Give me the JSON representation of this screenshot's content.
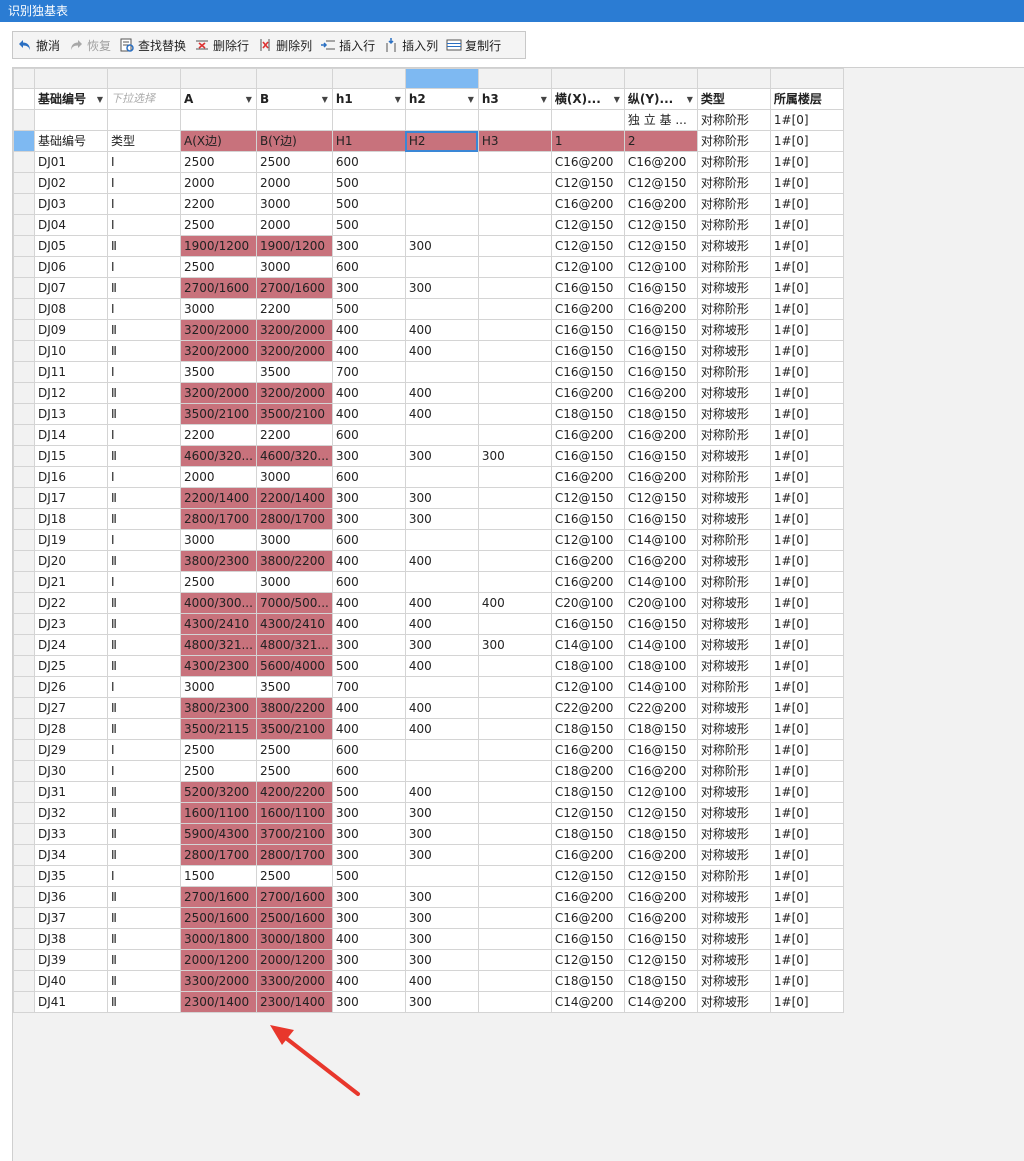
{
  "window": {
    "title": "识别独基表"
  },
  "toolbar": {
    "undo": "撤消",
    "redo": "恢复",
    "find_replace": "查找替换",
    "delete_row": "删除行",
    "delete_col": "删除列",
    "insert_row": "插入行",
    "insert_col": "插入列",
    "copy_row": "复制行"
  },
  "headers": [
    "基础编号",
    "下拉选择",
    "A",
    "B",
    "h1",
    "h2",
    "h3",
    "横(X)...",
    "纵(Y)...",
    "类型",
    "所属楼层"
  ],
  "row_blank": [
    "",
    "",
    "",
    "",
    "",
    "",
    "",
    "",
    "独 立 基 ...",
    "对称阶形",
    "1#[0]"
  ],
  "row_labels": [
    "基础编号",
    "类型",
    "A(X边)",
    "B(Y边)",
    "H1",
    "H2",
    "H3",
    "1",
    "2",
    "对称阶形",
    "1#[0]"
  ],
  "rows": [
    [
      "DJ01",
      "Ⅰ",
      "2500",
      "2500",
      "600",
      "",
      "",
      "C16@200",
      "C16@200",
      "对称阶形",
      "1#[0]"
    ],
    [
      "DJ02",
      "Ⅰ",
      "2000",
      "2000",
      "500",
      "",
      "",
      "C12@150",
      "C12@150",
      "对称阶形",
      "1#[0]"
    ],
    [
      "DJ03",
      "Ⅰ",
      "2200",
      "3000",
      "500",
      "",
      "",
      "C16@200",
      "C16@200",
      "对称阶形",
      "1#[0]"
    ],
    [
      "DJ04",
      "Ⅰ",
      "2500",
      "2000",
      "500",
      "",
      "",
      "C12@150",
      "C12@150",
      "对称阶形",
      "1#[0]"
    ],
    [
      "DJ05",
      "Ⅱ",
      "1900/1200",
      "1900/1200",
      "300",
      "300",
      "",
      "C12@150",
      "C12@150",
      "对称坡形",
      "1#[0]"
    ],
    [
      "DJ06",
      "Ⅰ",
      "2500",
      "3000",
      "600",
      "",
      "",
      "C12@100",
      "C12@100",
      "对称阶形",
      "1#[0]"
    ],
    [
      "DJ07",
      "Ⅱ",
      "2700/1600",
      "2700/1600",
      "300",
      "300",
      "",
      "C16@150",
      "C16@150",
      "对称坡形",
      "1#[0]"
    ],
    [
      "DJ08",
      "Ⅰ",
      "3000",
      "2200",
      "500",
      "",
      "",
      "C16@200",
      "C16@200",
      "对称阶形",
      "1#[0]"
    ],
    [
      "DJ09",
      "Ⅱ",
      "3200/2000",
      "3200/2000",
      "400",
      "400",
      "",
      "C16@150",
      "C16@150",
      "对称坡形",
      "1#[0]"
    ],
    [
      "DJ10",
      "Ⅱ",
      "3200/2000",
      "3200/2000",
      "400",
      "400",
      "",
      "C16@150",
      "C16@150",
      "对称坡形",
      "1#[0]"
    ],
    [
      "DJ11",
      "Ⅰ",
      "3500",
      "3500",
      "700",
      "",
      "",
      "C16@150",
      "C16@150",
      "对称阶形",
      "1#[0]"
    ],
    [
      "DJ12",
      "Ⅱ",
      "3200/2000",
      "3200/2000",
      "400",
      "400",
      "",
      "C16@200",
      "C16@200",
      "对称坡形",
      "1#[0]"
    ],
    [
      "DJ13",
      "Ⅱ",
      "3500/2100",
      "3500/2100",
      "400",
      "400",
      "",
      "C18@150",
      "C18@150",
      "对称坡形",
      "1#[0]"
    ],
    [
      "DJ14",
      "Ⅰ",
      "2200",
      "2200",
      "600",
      "",
      "",
      "C16@200",
      "C16@200",
      "对称阶形",
      "1#[0]"
    ],
    [
      "DJ15",
      "Ⅱ",
      "4600/320...",
      "4600/320...",
      "300",
      "300",
      "300",
      "C16@150",
      "C16@150",
      "对称坡形",
      "1#[0]"
    ],
    [
      "DJ16",
      "Ⅰ",
      "2000",
      "3000",
      "600",
      "",
      "",
      "C16@200",
      "C16@200",
      "对称阶形",
      "1#[0]"
    ],
    [
      "DJ17",
      "Ⅱ",
      "2200/1400",
      "2200/1400",
      "300",
      "300",
      "",
      "C12@150",
      "C12@150",
      "对称坡形",
      "1#[0]"
    ],
    [
      "DJ18",
      "Ⅱ",
      "2800/1700",
      "2800/1700",
      "300",
      "300",
      "",
      "C16@150",
      "C16@150",
      "对称坡形",
      "1#[0]"
    ],
    [
      "DJ19",
      "Ⅰ",
      "3000",
      "3000",
      "600",
      "",
      "",
      "C12@100",
      "C14@100",
      "对称阶形",
      "1#[0]"
    ],
    [
      "DJ20",
      "Ⅱ",
      "3800/2300",
      "3800/2200",
      "400",
      "400",
      "",
      "C16@200",
      "C16@200",
      "对称坡形",
      "1#[0]"
    ],
    [
      "DJ21",
      "Ⅰ",
      "2500",
      "3000",
      "600",
      "",
      "",
      "C16@200",
      "C14@100",
      "对称阶形",
      "1#[0]"
    ],
    [
      "DJ22",
      "Ⅱ",
      "4000/300...",
      "7000/500...",
      "400",
      "400",
      "400",
      "C20@100",
      "C20@100",
      "对称坡形",
      "1#[0]"
    ],
    [
      "DJ23",
      "Ⅱ",
      "4300/2410",
      "4300/2410",
      "400",
      "400",
      "",
      "C16@150",
      "C16@150",
      "对称坡形",
      "1#[0]"
    ],
    [
      "DJ24",
      "Ⅱ",
      "4800/321...",
      "4800/321...",
      "300",
      "300",
      "300",
      "C14@100",
      "C14@100",
      "对称坡形",
      "1#[0]"
    ],
    [
      "DJ25",
      "Ⅱ",
      "4300/2300",
      "5600/4000",
      "500",
      "400",
      "",
      "C18@100",
      "C18@100",
      "对称坡形",
      "1#[0]"
    ],
    [
      "DJ26",
      "Ⅰ",
      "3000",
      "3500",
      "700",
      "",
      "",
      "C12@100",
      "C14@100",
      "对称阶形",
      "1#[0]"
    ],
    [
      "DJ27",
      "Ⅱ",
      "3800/2300",
      "3800/2200",
      "400",
      "400",
      "",
      "C22@200",
      "C22@200",
      "对称坡形",
      "1#[0]"
    ],
    [
      "DJ28",
      "Ⅱ",
      "3500/2115",
      "3500/2100",
      "400",
      "400",
      "",
      "C18@150",
      "C18@150",
      "对称坡形",
      "1#[0]"
    ],
    [
      "DJ29",
      "Ⅰ",
      "2500",
      "2500",
      "600",
      "",
      "",
      "C16@200",
      "C16@150",
      "对称阶形",
      "1#[0]"
    ],
    [
      "DJ30",
      "Ⅰ",
      "2500",
      "2500",
      "600",
      "",
      "",
      "C18@200",
      "C16@200",
      "对称阶形",
      "1#[0]"
    ],
    [
      "DJ31",
      "Ⅱ",
      "5200/3200",
      "4200/2200",
      "500",
      "400",
      "",
      "C18@150",
      "C12@100",
      "对称坡形",
      "1#[0]"
    ],
    [
      "DJ32",
      "Ⅱ",
      "1600/1100",
      "1600/1100",
      "300",
      "300",
      "",
      "C12@150",
      "C12@150",
      "对称坡形",
      "1#[0]"
    ],
    [
      "DJ33",
      "Ⅱ",
      "5900/4300",
      "3700/2100",
      "300",
      "300",
      "",
      "C18@150",
      "C18@150",
      "对称坡形",
      "1#[0]"
    ],
    [
      "DJ34",
      "Ⅱ",
      "2800/1700",
      "2800/1700",
      "300",
      "300",
      "",
      "C16@200",
      "C16@200",
      "对称坡形",
      "1#[0]"
    ],
    [
      "DJ35",
      "Ⅰ",
      "1500",
      "2500",
      "500",
      "",
      "",
      "C12@150",
      "C12@150",
      "对称阶形",
      "1#[0]"
    ],
    [
      "DJ36",
      "Ⅱ",
      "2700/1600",
      "2700/1600",
      "300",
      "300",
      "",
      "C16@200",
      "C16@200",
      "对称坡形",
      "1#[0]"
    ],
    [
      "DJ37",
      "Ⅱ",
      "2500/1600",
      "2500/1600",
      "300",
      "300",
      "",
      "C16@200",
      "C16@200",
      "对称坡形",
      "1#[0]"
    ],
    [
      "DJ38",
      "Ⅱ",
      "3000/1800",
      "3000/1800",
      "400",
      "300",
      "",
      "C16@150",
      "C16@150",
      "对称坡形",
      "1#[0]"
    ],
    [
      "DJ39",
      "Ⅱ",
      "2000/1200",
      "2000/1200",
      "300",
      "300",
      "",
      "C12@150",
      "C12@150",
      "对称坡形",
      "1#[0]"
    ],
    [
      "DJ40",
      "Ⅱ",
      "3300/2000",
      "3300/2000",
      "400",
      "400",
      "",
      "C18@150",
      "C18@150",
      "对称坡形",
      "1#[0]"
    ],
    [
      "DJ41",
      "Ⅱ",
      "2300/1400",
      "2300/1400",
      "300",
      "300",
      "",
      "C14@200",
      "C14@200",
      "对称坡形",
      "1#[0]"
    ]
  ],
  "colors": {
    "highlight": "#c8727c",
    "selection": "#7eb9f2",
    "titlebar": "#2b7cd3",
    "arrow": "#e8372c"
  }
}
